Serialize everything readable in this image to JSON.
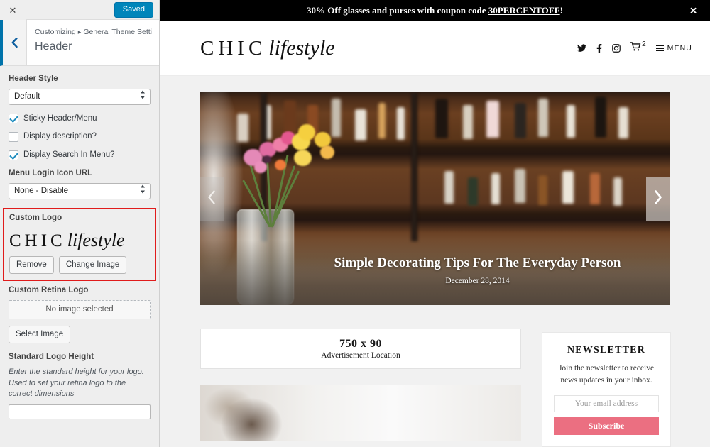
{
  "customizer": {
    "close_label": "✕",
    "save_label": "Saved",
    "back_icon": "chevron-left-icon",
    "breadcrumb_prefix": "Customizing",
    "breadcrumb_parent": "General Theme Setti...",
    "section_title": "Header",
    "accent_color": "#0085ba",
    "highlight_color": "#e01b1b",
    "controls": {
      "header_style_label": "Header Style",
      "header_style_value": "Default",
      "sticky_header_label": "Sticky Header/Menu",
      "sticky_header_checked": true,
      "display_description_label": "Display description?",
      "display_description_checked": false,
      "display_search_label": "Display Search In Menu?",
      "display_search_checked": true,
      "menu_login_label": "Menu Login Icon URL",
      "menu_login_value": "None - Disable",
      "custom_logo_label": "Custom Logo",
      "logo_text_primary": "CHIC",
      "logo_text_secondary": "lifestyle",
      "remove_label": "Remove",
      "change_image_label": "Change Image",
      "retina_logo_label": "Custom Retina Logo",
      "retina_placeholder": "No image selected",
      "select_image_label": "Select Image",
      "logo_height_label": "Standard Logo Height",
      "logo_height_desc": "Enter the standard height for your logo. Used to set your retina logo to the correct dimensions",
      "logo_height_value": ""
    }
  },
  "preview": {
    "announcement": {
      "text_before": "30% Off glasses and purses with coupon code ",
      "coupon_code": "30PERCENTOFF",
      "text_after": "!",
      "close_label": "✕"
    },
    "site_header": {
      "logo_primary": "CHIC",
      "logo_secondary": "lifestyle",
      "cart_count": "2",
      "menu_label": "MENU"
    },
    "slider": {
      "title": "Simple Decorating Tips For The Everyday Person",
      "date": "December 28, 2014",
      "prev_icon": "chevron-left-icon",
      "next_icon": "chevron-right-icon"
    },
    "advertisement": {
      "size": "750 x 90",
      "label": "Advertisement Location"
    },
    "newsletter": {
      "title": "NEWSLETTER",
      "description": "Join the newsletter to receive news updates in your inbox.",
      "email_placeholder": "Your email address",
      "email_value": "",
      "subscribe_label": "Subscribe",
      "button_color": "#eb6f81"
    }
  }
}
